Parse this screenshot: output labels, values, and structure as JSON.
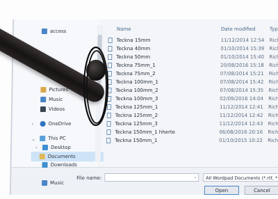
{
  "header": {
    "name_label": "Name",
    "date_label": "Date modified",
    "type_label": "Type"
  },
  "nav": {
    "items": [
      {
        "label": "access",
        "icon": "star-icon"
      },
      {
        "label": "Pictures",
        "icon": "pictures-icon"
      },
      {
        "label": "Music",
        "icon": "music-icon"
      },
      {
        "label": "Videos",
        "icon": "videos-icon"
      },
      {
        "label": "OneDrive",
        "icon": "cloud-icon"
      },
      {
        "label": "This PC",
        "icon": "computer-icon"
      },
      {
        "label": "Desktop",
        "icon": "desktop-icon"
      },
      {
        "label": "Documents",
        "icon": "folder-icon"
      },
      {
        "label": "Downloads",
        "icon": "download-icon"
      },
      {
        "label": "Music",
        "icon": "music-icon"
      }
    ]
  },
  "files": [
    {
      "name": "Teckna 15mm",
      "date": "11/12/2014 12:54",
      "type": "Rich"
    },
    {
      "name": "Teckna 40mm",
      "date": "01/10/2014 15:39",
      "type": "Rich"
    },
    {
      "name": "Teckna 50mm",
      "date": "01/10/2014 15:40",
      "type": "Rich"
    },
    {
      "name": "Teckna 75mm_1",
      "date": "20/08/2016 15:18",
      "type": "Rich"
    },
    {
      "name": "Teckna 75mm_2",
      "date": "07/08/2014 15:21",
      "type": "Rich"
    },
    {
      "name": "Teckna 100mm_1",
      "date": "07/08/2014 15:42",
      "type": "Rich"
    },
    {
      "name": "Teckna 100mm_2",
      "date": "07/08/2014 15:35",
      "type": "Rich"
    },
    {
      "name": "Teckna 100mm_3",
      "date": "02/09/2016 14:04",
      "type": "Rich"
    },
    {
      "name": "Teckna 125mm_1",
      "date": "11/12/2014 12:41",
      "type": "Rich"
    },
    {
      "name": "Teckna 125mm_2",
      "date": "11/12/2014 12:42",
      "type": "Rich"
    },
    {
      "name": "Teckna 125mm_3",
      "date": "11/12/2014 12:43",
      "type": "Rich"
    },
    {
      "name": "Teckna 150mm_1 hherte",
      "date": "06/08/2016 20:16",
      "type": "Rich"
    },
    {
      "name": "Teckna 150mm_1",
      "date": "01/10/2015 10:22",
      "type": "Rich"
    }
  ],
  "footer": {
    "file_name_label": "File name:",
    "file_name_value": "",
    "filter_label": "All Wordpad Documents (*.rtf, *",
    "open_label": "Open",
    "cancel_label": "Cancel"
  },
  "colors": {
    "accent": "#4f86c6",
    "selected": "#cde3f7",
    "annotation": "#111111"
  }
}
